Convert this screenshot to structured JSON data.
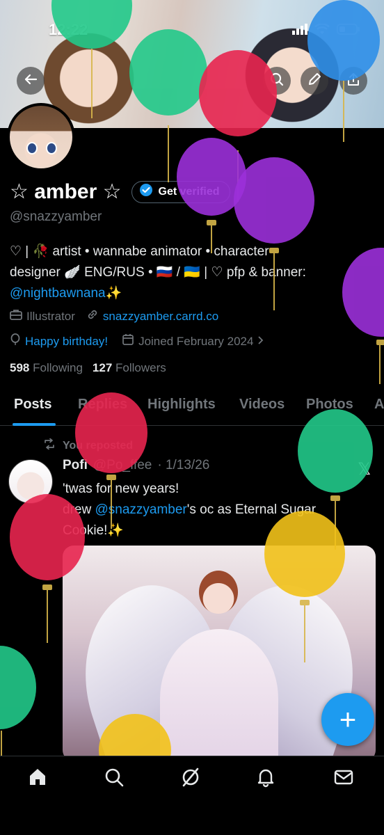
{
  "status_bar": {
    "time": "12:22"
  },
  "profile": {
    "name": "☆ amber ☆",
    "verify_label": "Get verified",
    "handle": "@snazzyamber",
    "bio_line1": "♡ | 🥀 artist • wannabe animator • character",
    "bio_line2": "designer 🪽 ENG/RUS • 🇷🇺 / 🇺🇦 | ♡ pfp & banner:",
    "bio_link": "@nightbawnana",
    "bio_sparkle": "✨",
    "occupation": "Illustrator",
    "website": "snazzyamber.carrd.co",
    "birthday": "Happy birthday!",
    "joined": "Joined February 2024",
    "following_count": "598",
    "following_label": "Following",
    "followers_count": "127",
    "followers_label": "Followers"
  },
  "tabs": [
    {
      "label": "Posts"
    },
    {
      "label": "Replies"
    },
    {
      "label": "Highlights"
    },
    {
      "label": "Videos"
    },
    {
      "label": "Photos"
    },
    {
      "label": "A"
    }
  ],
  "post": {
    "repost_label": "You reposted",
    "author": "Pofi",
    "author_handle": "@Po_ffee",
    "date": "· 1/13/26",
    "text_line1": "'twas for new years!",
    "text_line2_prefix": "drew ",
    "text_line2_link": "@snazzyamber",
    "text_line2_suffix": "'s oc as Eternal Sugar",
    "text_line3": "Cookie!✨",
    "x_mark": "𝕏"
  },
  "fab": {
    "label": "+"
  },
  "icons": {
    "back": "back-arrow-icon",
    "search": "search-icon",
    "edit": "pencil-icon",
    "share": "share-icon",
    "home": "home-icon",
    "explore": "search-icon",
    "grok": "slash-circle-icon",
    "notifications": "bell-icon",
    "messages": "mail-icon"
  },
  "colors": {
    "accent": "#1d9bf0",
    "balloon_green": "#22c98a",
    "balloon_red": "#e8254f",
    "balloon_purple": "#9b30d9",
    "balloon_yellow": "#f2c21a",
    "balloon_blue": "#2f8fe8"
  }
}
